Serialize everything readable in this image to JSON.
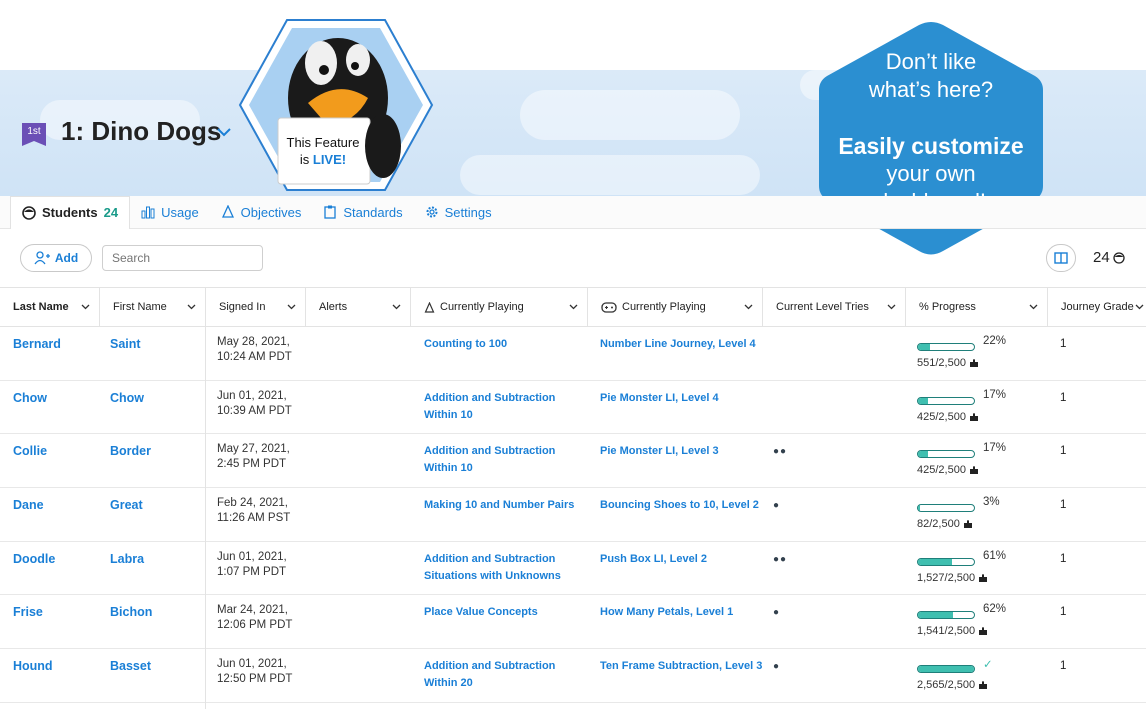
{
  "class": {
    "grade_badge": "1st",
    "title": "1: Dino Dogs"
  },
  "feature_badge": {
    "line1": "This Feature",
    "line2_prefix": "is ",
    "line2_live": "LIVE!"
  },
  "promo": {
    "line1": "Don’t like",
    "line2": "what’s here?",
    "line3": "Easily customize",
    "line4": "your own",
    "line5": "dashboard!"
  },
  "tabs": [
    {
      "label": "Students",
      "count": "24",
      "icon": "student-icon"
    },
    {
      "label": "Usage",
      "icon": "bar-chart-icon"
    },
    {
      "label": "Objectives",
      "icon": "bell-icon"
    },
    {
      "label": "Standards",
      "icon": "clipboard-icon"
    },
    {
      "label": "Settings",
      "icon": "gear-icon"
    }
  ],
  "toolbar": {
    "add_label": "Add",
    "search_placeholder": "Search",
    "student_count": "24"
  },
  "columns": [
    "Last Name",
    "First Name",
    "Signed In",
    "Alerts",
    "Currently Playing",
    "Currently Playing",
    "Current Level Tries",
    "% Progress",
    "Journey Grade"
  ],
  "rows": [
    {
      "last": "Bernard",
      "first": "Saint",
      "signed1": "May 28, 2021,",
      "signed2": "10:24 AM PDT",
      "obj1": "Counting to 100",
      "obj2": "",
      "game": "Number Line Journey, Level 4",
      "tries": "",
      "pct": "22%",
      "progress": 0.22,
      "frac": "551/2,500",
      "grade": "1"
    },
    {
      "last": "Chow",
      "first": "Chow",
      "signed1": "Jun 01, 2021,",
      "signed2": "10:39 AM PDT",
      "obj1": "Addition and Subtraction",
      "obj2": "Within 10",
      "game": "Pie Monster LI, Level 4",
      "tries": "",
      "pct": "17%",
      "progress": 0.17,
      "frac": "425/2,500",
      "grade": "1"
    },
    {
      "last": "Collie",
      "first": "Border",
      "signed1": "May 27, 2021,",
      "signed2": "2:45 PM PDT",
      "obj1": "Addition and Subtraction",
      "obj2": "Within 10",
      "game": "Pie Monster LI, Level 3",
      "tries": "●●",
      "pct": "17%",
      "progress": 0.17,
      "frac": "425/2,500",
      "grade": "1"
    },
    {
      "last": "Dane",
      "first": "Great",
      "signed1": "Feb 24, 2021,",
      "signed2": "11:26 AM PST",
      "obj1": "Making 10 and Number Pairs",
      "obj2": "",
      "game": "Bouncing Shoes to 10, Level 2",
      "tries": "●",
      "pct": "3%",
      "progress": 0.03,
      "frac": "82/2,500",
      "grade": "1"
    },
    {
      "last": "Doodle",
      "first": "Labra",
      "signed1": "Jun 01, 2021,",
      "signed2": "1:07 PM PDT",
      "obj1": "Addition and Subtraction",
      "obj2": "Situations with Unknowns",
      "game": "Push Box LI, Level 2",
      "tries": "●●",
      "pct": "61%",
      "progress": 0.61,
      "frac": "1,527/2,500",
      "grade": "1"
    },
    {
      "last": "Frise",
      "first": "Bichon",
      "signed1": "Mar 24, 2021,",
      "signed2": "12:06 PM PDT",
      "obj1": "Place Value Concepts",
      "obj2": "",
      "game": "How Many Petals, Level 1",
      "tries": "●",
      "pct": "62%",
      "progress": 0.62,
      "frac": "1,541/2,500",
      "grade": "1"
    },
    {
      "last": "Hound",
      "first": "Basset",
      "signed1": "Jun 01, 2021,",
      "signed2": "12:50 PM PDT",
      "obj1": "Addition and Subtraction",
      "obj2": "Within 20",
      "game": "Ten Frame Subtraction, Level 3",
      "tries": "●",
      "pct": "✓",
      "progress": 1.0,
      "frac": "2,565/2,500",
      "grade": "1"
    }
  ]
}
